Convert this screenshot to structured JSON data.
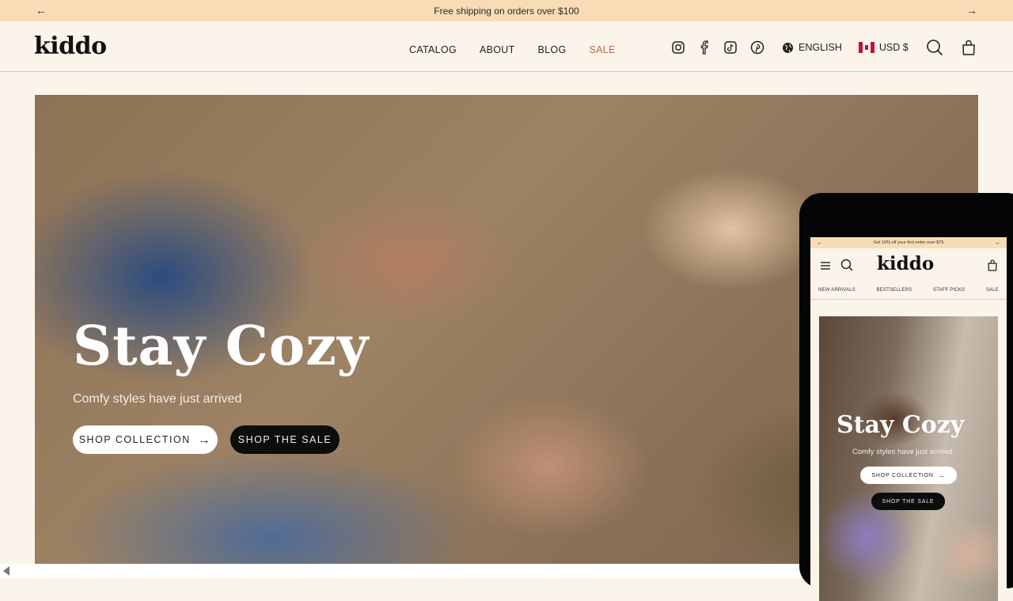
{
  "announcement": {
    "text": "Free shipping on orders over $100",
    "prev_icon": "arrow-left-icon",
    "next_icon": "arrow-right-icon"
  },
  "header": {
    "logo": "kiddo",
    "nav": [
      {
        "label": "CATALOG"
      },
      {
        "label": "ABOUT"
      },
      {
        "label": "BLOG"
      },
      {
        "label": "SALE",
        "highlight_color": "#c4674f"
      }
    ],
    "social_icons": [
      "instagram-icon",
      "facebook-icon",
      "tiktok-icon",
      "pinterest-icon"
    ],
    "language": "ENGLISH",
    "currency": "USD $",
    "currency_flag": "canada-flag-icon",
    "search_icon": "search-icon",
    "cart_icon": "shopping-bag-icon"
  },
  "hero": {
    "title": "Stay Cozy",
    "subtitle": "Comfy styles have just arrived",
    "primary_button": "SHOP COLLECTION",
    "secondary_button": "SHOP THE SALE"
  },
  "mobile_preview": {
    "announcement": "Get 10% off your first order over $75",
    "logo": "kiddo",
    "nav": [
      "NEW ARRIVALS",
      "BESTSELLERS",
      "STAFF PICKS",
      "SALE"
    ],
    "hero": {
      "title": "Stay Cozy",
      "subtitle": "Comfy styles have just arrived",
      "primary_button": "SHOP COLLECTION",
      "secondary_button": "SHOP THE SALE"
    }
  },
  "colors": {
    "background": "#fbf4ea",
    "announcement_bar": "#f7dcb6",
    "sale_accent": "#c4674f",
    "button_dark": "#0d0d0d"
  }
}
